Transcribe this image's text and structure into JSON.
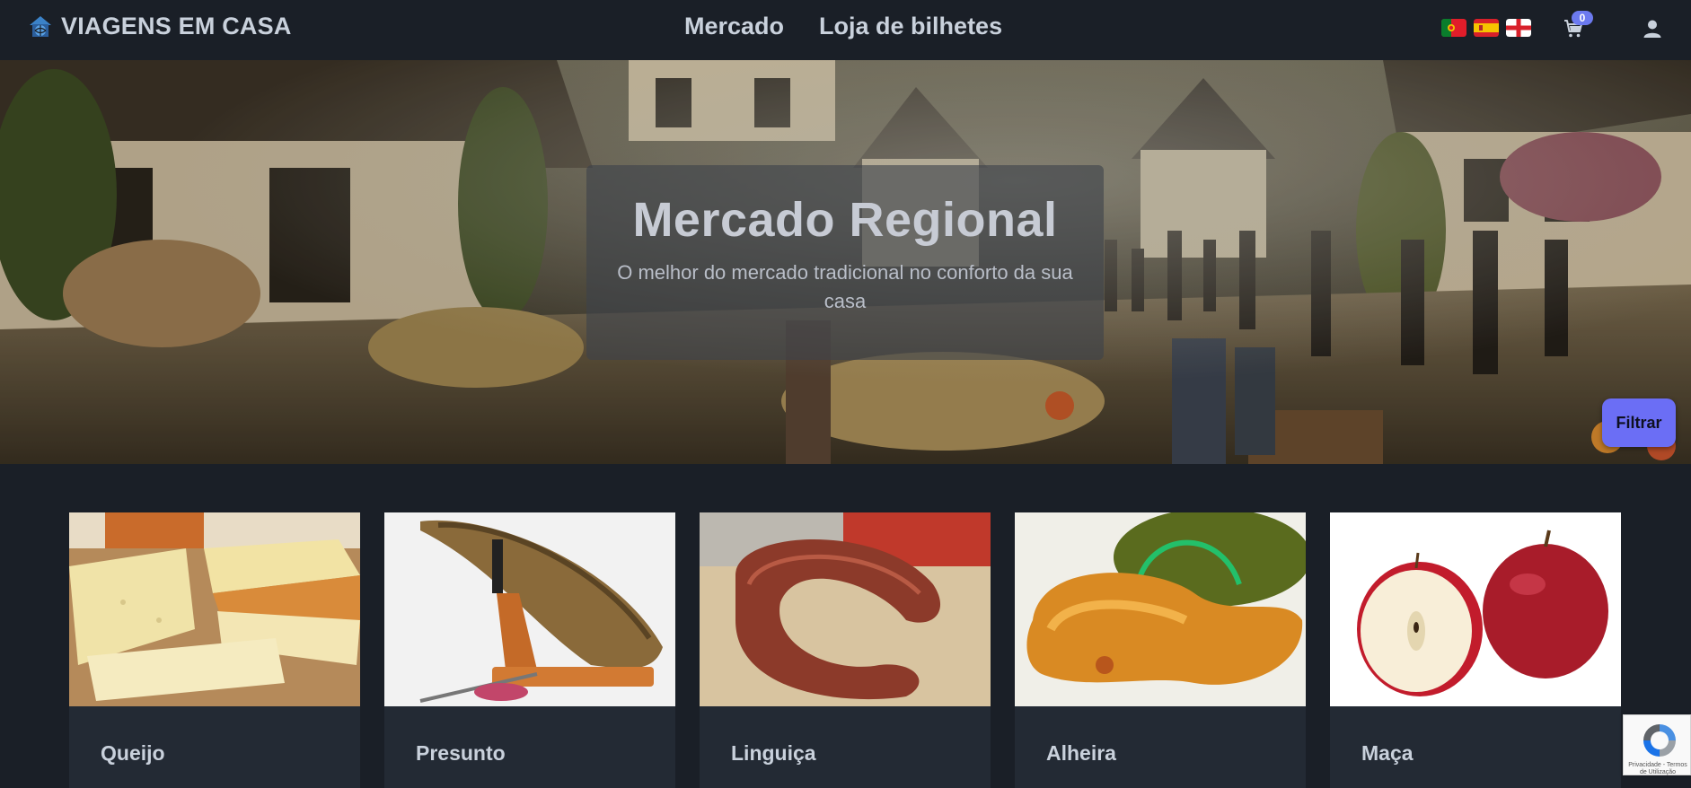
{
  "nav": {
    "brand": "VIAGENS EM CASA",
    "links": [
      "Mercado",
      "Loja de bilhetes"
    ],
    "languages": [
      "pt-flag-icon",
      "es-flag-icon",
      "en-flag-icon"
    ],
    "cart_count": "0",
    "icons": {
      "cart": "cart-icon",
      "user": "user-icon",
      "logo": "globe-house-logo"
    }
  },
  "hero": {
    "title": "Mercado Regional",
    "subtitle": "O melhor do mercado tradicional no conforto da sua casa",
    "filter_label": "Filtrar"
  },
  "products": [
    {
      "name": "Queijo"
    },
    {
      "name": "Presunto"
    },
    {
      "name": "Linguiça"
    },
    {
      "name": "Alheira"
    },
    {
      "name": "Maça"
    }
  ],
  "recaptcha": {
    "text": "Privacidade - Termos de Utilização"
  },
  "colors": {
    "background": "#1a1f27",
    "card": "#232a34",
    "accent": "#6b6ef5",
    "text": "#c9d1dc"
  }
}
